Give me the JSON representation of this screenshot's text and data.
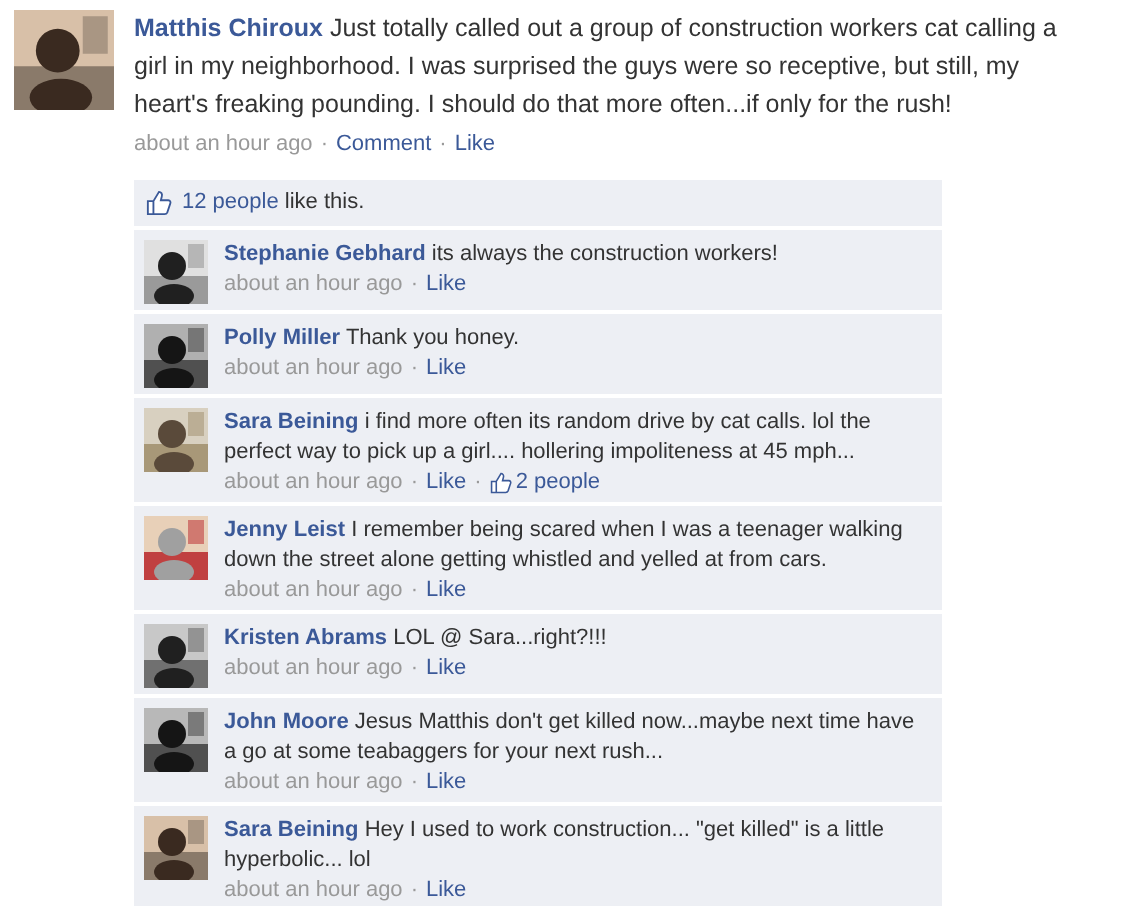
{
  "separator": "·",
  "post": {
    "author": "Matthis Chiroux",
    "text": "Just totally called out a group of construction workers cat calling a girl in my neighborhood. I was surprised the guys were so receptive, but still, my heart's freaking pounding. I should do that more often...if only for the rush!",
    "time": "about an hour ago",
    "actions": [
      "Comment",
      "Like"
    ]
  },
  "likes": {
    "count": "12 people",
    "text": "like this."
  },
  "comments": [
    {
      "author": "Stephanie Gebhard",
      "text": "its always the construction workers!",
      "time": "about an hour ago",
      "like": "Like"
    },
    {
      "author": "Polly Miller",
      "text": "Thank you honey.",
      "time": "about an hour ago",
      "like": "Like"
    },
    {
      "author": "Sara Beining",
      "text": "i find more often its random drive by cat calls. lol the perfect way to pick up a girl.... hollering impoliteness at 45 mph...",
      "time": "about an hour ago",
      "like": "Like",
      "likers": "2 people"
    },
    {
      "author": "Jenny Leist",
      "text": "I remember being scared when I was a teenager walking down the street alone getting whistled and yelled at from cars.",
      "time": "about an hour ago",
      "like": "Like"
    },
    {
      "author": "Kristen Abrams",
      "text": "LOL @ Sara...right?!!!",
      "time": "about an hour ago",
      "like": "Like"
    },
    {
      "author": "John Moore",
      "text": "Jesus Matthis don't get killed now...maybe next time have a go at some teabaggers for your next rush...",
      "time": "about an hour ago",
      "like": "Like"
    },
    {
      "author": "Sara Beining",
      "text": "Hey I used to work construction... \"get killed\" is a little hyperbolic... lol",
      "time": "about an hour ago",
      "like": "Like"
    }
  ]
}
